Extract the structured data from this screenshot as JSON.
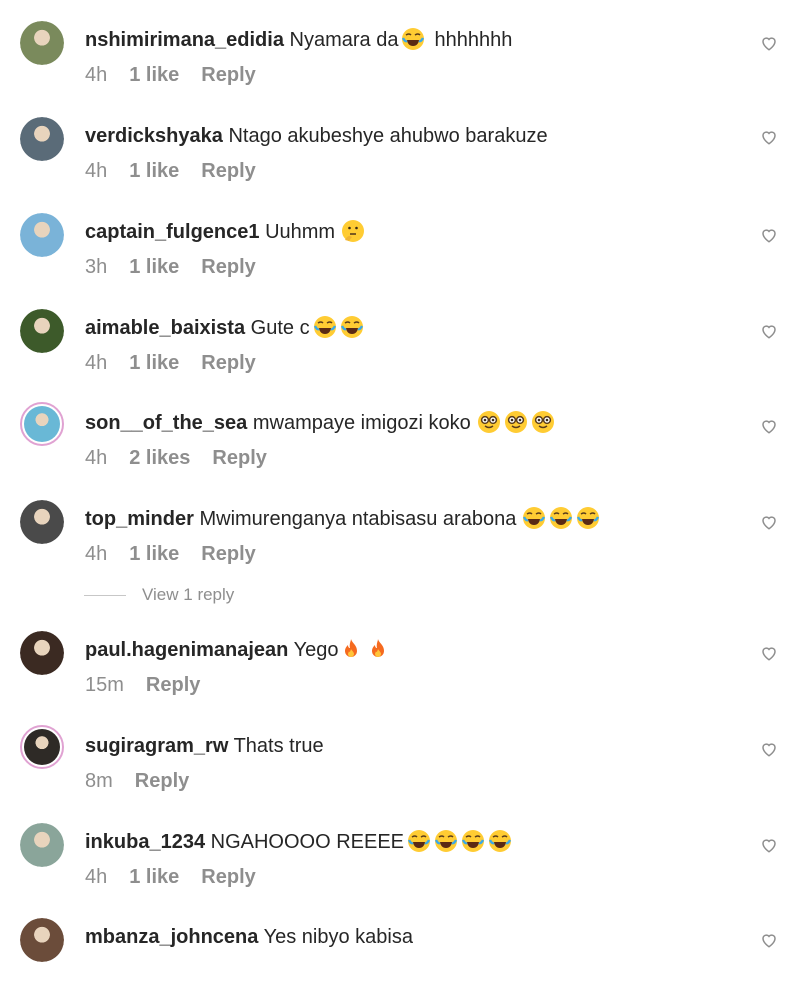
{
  "comments": [
    {
      "username": "nshimirimana_edidia",
      "text": "Nyamara da",
      "after": "hhhhhhh",
      "emojis": [
        "laugh-cry"
      ],
      "time": "4h",
      "likes": "1 like",
      "reply": "Reply",
      "avatar_color": "#7a8a5c"
    },
    {
      "username": "verdickshyaka",
      "text": "Ntago akubeshye ahubwo barakuze",
      "emojis": [],
      "time": "4h",
      "likes": "1 like",
      "reply": "Reply",
      "avatar_color": "#5a6b78"
    },
    {
      "username": "captain_fulgence1",
      "text": "Uuhmm",
      "emojis": [
        "thinking"
      ],
      "time": "3h",
      "likes": "1 like",
      "reply": "Reply",
      "avatar_color": "#7ab3d8"
    },
    {
      "username": "aimable_baixista",
      "text": "Gute c",
      "emojis": [
        "laugh-cry",
        "laugh-cry"
      ],
      "time": "4h",
      "likes": "1 like",
      "reply": "Reply",
      "avatar_color": "#3d5a2a"
    },
    {
      "username": "son__of_the_sea",
      "text": "mwampaye imigozi koko",
      "emojis": [
        "nerd",
        "nerd",
        "nerd"
      ],
      "time": "4h",
      "likes": "2 likes",
      "reply": "Reply",
      "avatar_color": "#69b8d6"
    },
    {
      "username": "top_minder",
      "text": "Mwimurenganya ntabisasu arabona",
      "emojis": [
        "laugh-cry",
        "laugh-cry",
        "laugh-cry"
      ],
      "time": "4h",
      "likes": "1 like",
      "reply": "Reply",
      "avatar_color": "#4a4a4a"
    },
    {
      "username": "paul.hagenimanajean",
      "text": "Yego",
      "emojis": [
        "fire",
        "fire"
      ],
      "time": "15m",
      "likes": "",
      "reply": "Reply",
      "avatar_color": "#3b2a22"
    },
    {
      "username": "sugiragram_rw",
      "text": "Thats true",
      "emojis": [],
      "time": "8m",
      "likes": "",
      "reply": "Reply",
      "avatar_color": "#2e2a26"
    },
    {
      "username": "inkuba_1234",
      "text": "NGAHOOOO REEEE",
      "emojis": [
        "laugh-cry",
        "laugh-cry",
        "laugh-cry",
        "laugh-cry"
      ],
      "time": "4h",
      "likes": "1 like",
      "reply": "Reply",
      "avatar_color": "#8aa59a"
    },
    {
      "username": "mbanza_johncena",
      "text": "Yes nibyo kabisa",
      "emojis": [],
      "time": "",
      "likes": "",
      "reply": "",
      "avatar_color": "#6b4c3a"
    }
  ],
  "view_replies": "View 1 reply",
  "colors": {
    "text": "#262626",
    "muted": "#8e8e8e",
    "heart": "#8e8e8e"
  }
}
